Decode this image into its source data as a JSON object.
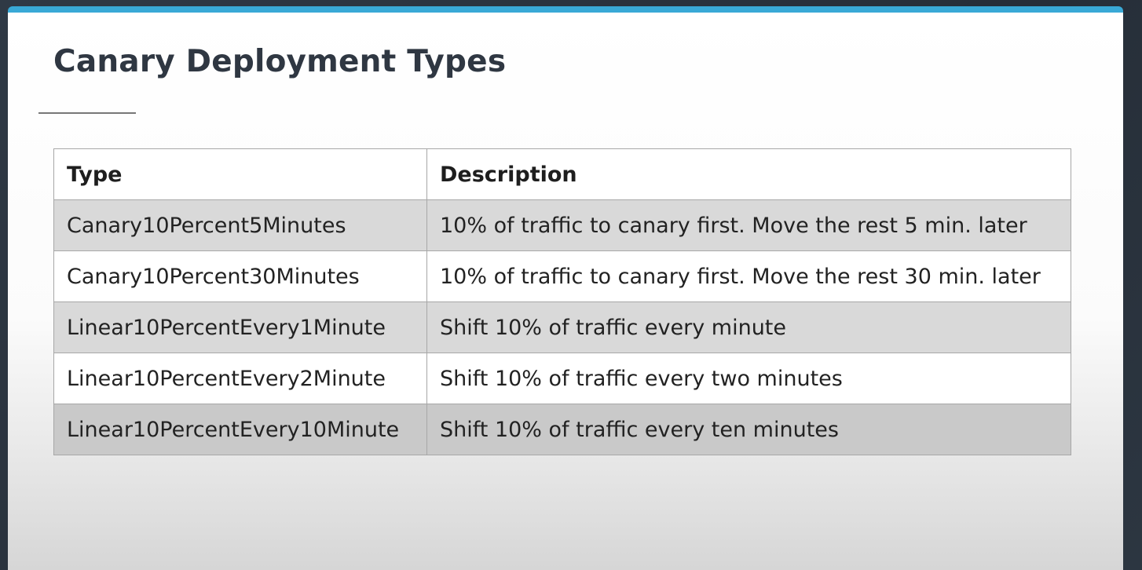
{
  "slide": {
    "title": "Canary Deployment Types"
  },
  "table": {
    "headers": {
      "type": "Type",
      "description": "Description"
    },
    "rows": [
      {
        "type": "Canary10Percent5Minutes",
        "description": "10% of traffic to canary first. Move the rest 5 min. later"
      },
      {
        "type": "Canary10Percent30Minutes",
        "description": "10% of traffic to canary first. Move the rest 30 min. later"
      },
      {
        "type": "Linear10PercentEvery1Minute",
        "description": "Shift 10% of traffic every minute"
      },
      {
        "type": "Linear10PercentEvery2Minute",
        "description": "Shift 10% of traffic every two minutes"
      },
      {
        "type": "Linear10PercentEvery10Minute",
        "description": "Shift 10% of traffic every ten minutes"
      }
    ]
  },
  "colors": {
    "accent_bar": "#39a9d6",
    "title_text": "#2f3742",
    "row_shaded": "#d9d9d9",
    "border": "#a7a7a7"
  }
}
